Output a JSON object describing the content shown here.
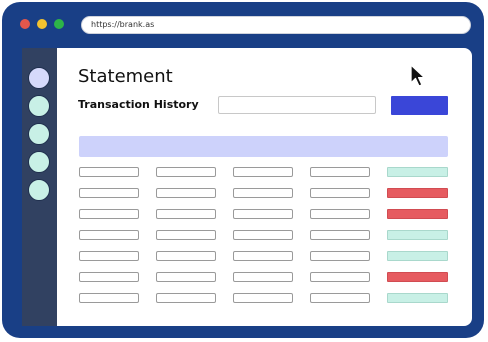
{
  "browser": {
    "url": "https://brank.as",
    "traffic_lights": {
      "close": "#e2574c",
      "minimize": "#f2c230",
      "maximize": "#2db548"
    }
  },
  "sidebar": {
    "items": [
      {
        "name": "nav-item-1",
        "color": "#d5d9fb"
      },
      {
        "name": "nav-item-2",
        "color": "#c8f0e6"
      },
      {
        "name": "nav-item-3",
        "color": "#c8f0e6"
      },
      {
        "name": "nav-item-4",
        "color": "#c8f0e6"
      },
      {
        "name": "nav-item-5",
        "color": "#c8f0e6"
      }
    ]
  },
  "page": {
    "title": "Statement",
    "section_title": "Transaction History"
  },
  "search": {
    "value": "",
    "placeholder": ""
  },
  "primary_button": {
    "label": "",
    "color": "#3a46d8"
  },
  "table": {
    "header_color": "#cdd2fb",
    "status_colors": {
      "success": "#c8f0e6",
      "failed": "#e65b60"
    },
    "rows": [
      {
        "status": "success"
      },
      {
        "status": "failed"
      },
      {
        "status": "failed"
      },
      {
        "status": "success"
      },
      {
        "status": "success"
      },
      {
        "status": "failed"
      },
      {
        "status": "success"
      }
    ]
  }
}
